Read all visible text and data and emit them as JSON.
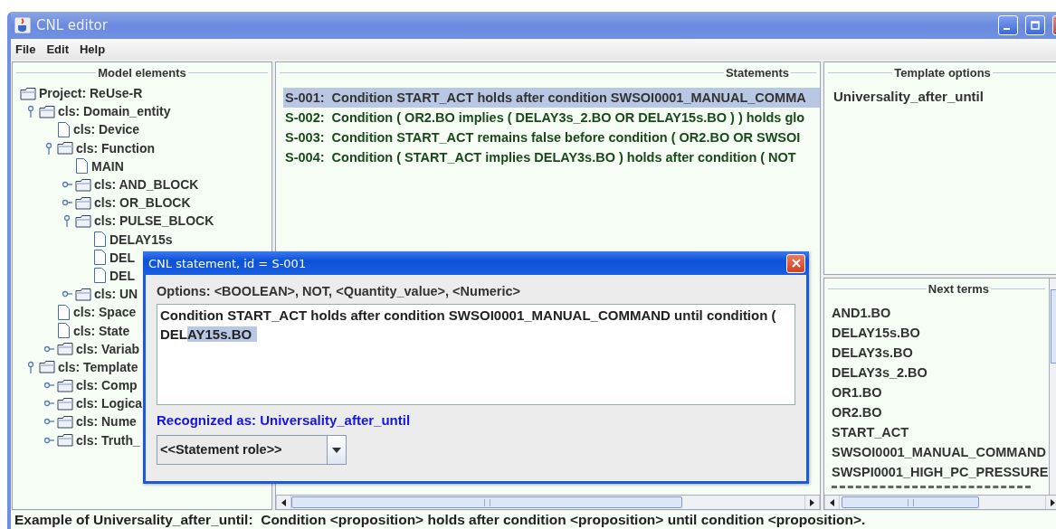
{
  "window": {
    "title": "CNL editor"
  },
  "menu": [
    "File",
    "Edit",
    "Help"
  ],
  "model_elements": {
    "title": "Model elements",
    "tree": [
      {
        "label": "Project: ReUse-R",
        "kind": "folder",
        "children": [
          {
            "label": "cls: Domain_entity",
            "kind": "folder",
            "expanded": true,
            "children": [
              {
                "label": "cls: Device",
                "kind": "file"
              },
              {
                "label": "cls: Function",
                "kind": "folder",
                "expanded": true,
                "children": [
                  {
                    "label": "MAIN",
                    "kind": "file"
                  },
                  {
                    "label": "cls: AND_BLOCK",
                    "kind": "folder",
                    "expanded": false
                  },
                  {
                    "label": "cls: OR_BLOCK",
                    "kind": "folder",
                    "expanded": false
                  },
                  {
                    "label": "cls: PULSE_BLOCK",
                    "kind": "folder",
                    "expanded": true,
                    "children": [
                      {
                        "label": "DELAY15s",
                        "kind": "file"
                      },
                      {
                        "label": "DEL",
                        "kind": "file"
                      },
                      {
                        "label": "DEL",
                        "kind": "file"
                      }
                    ]
                  },
                  {
                    "label": "cls: UN",
                    "kind": "folder",
                    "expanded": false
                  }
                ]
              },
              {
                "label": "cls: Space",
                "kind": "file"
              },
              {
                "label": "cls: State",
                "kind": "file"
              },
              {
                "label": "cls: Variab",
                "kind": "folder",
                "expanded": false
              }
            ]
          },
          {
            "label": "cls: Template",
            "kind": "folder",
            "expanded": true,
            "children": [
              {
                "label": "cls: Comp",
                "kind": "folder",
                "expanded": false
              },
              {
                "label": "cls: Logica",
                "kind": "folder",
                "expanded": false
              },
              {
                "label": "cls: Nume",
                "kind": "folder",
                "expanded": false
              },
              {
                "label": "cls: Truth_",
                "kind": "folder",
                "expanded": false
              }
            ]
          }
        ]
      }
    ]
  },
  "statements": {
    "title": "Statements",
    "rows": [
      {
        "id": "S-001:",
        "text": "Condition START_ACT holds after condition SWSOI0001_MANUAL_COMMA",
        "selected": true
      },
      {
        "id": "S-002:",
        "text": "Condition ( OR2.BO implies ( DELAY3s_2.BO OR DELAY15s.BO ) ) holds glo",
        "selected": false
      },
      {
        "id": "S-003:",
        "text": "Condition START_ACT remains false before condition ( OR2.BO OR SWSOI",
        "selected": false
      },
      {
        "id": "S-004:",
        "text": "Condition ( START_ACT implies DELAY3s.BO ) holds after condition ( NOT",
        "selected": false
      }
    ]
  },
  "template_options": {
    "title": "Template options",
    "items": [
      "Universality_after_until"
    ]
  },
  "next_terms": {
    "title": "Next terms",
    "items": [
      "AND1.BO",
      "DELAY15s.BO",
      "DELAY3s.BO",
      "DELAY3s_2.BO",
      "OR1.BO",
      "OR2.BO",
      "START_ACT",
      "SWSOI0001_MANUAL_COMMAND",
      "SWSPI0001_HIGH_PC_PRESSURE"
    ]
  },
  "dialog": {
    "title": "CNL statement, id = S-001",
    "options": "Options: <BOOLEAN>, NOT, <Quantity_value>, <Numeric>",
    "value": "Condition START_ACT holds after condition SWSOI0001_MANUAL_COMMAND until condition ( DEL",
    "selected_text": "AY15s.BO",
    "recognized": "Recognized as: Universality_after_until",
    "role": "<<Statement role>>"
  },
  "status_bar": "Example of Universality_after_until:  Condition <proposition> holds after condition <proposition> until condition <proposition>."
}
